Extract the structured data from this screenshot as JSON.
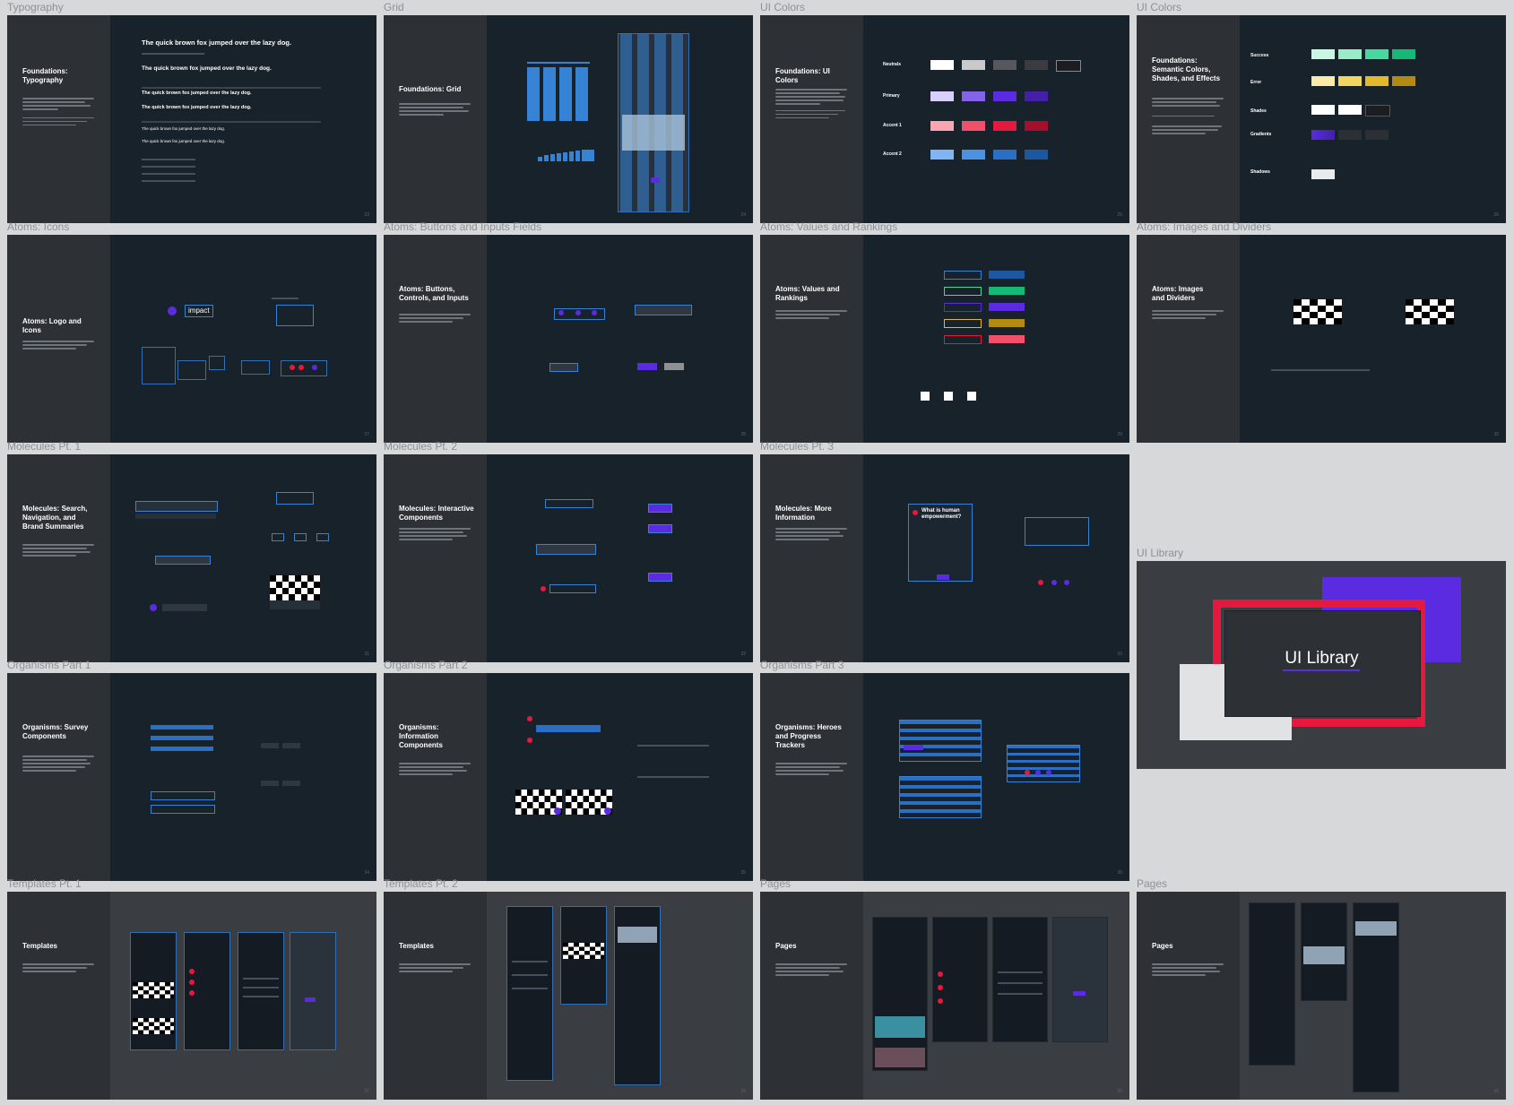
{
  "frames": [
    {
      "label": "Typography",
      "title": "Foundations:\nTypography",
      "page": "23",
      "sample": "The quick brown fox jumped over the lazy dog."
    },
    {
      "label": "Grid",
      "title": "Foundations: Grid",
      "page": "24"
    },
    {
      "label": "UI Colors",
      "title": "Foundations: UI Colors",
      "page": "25",
      "rows": [
        "Neutrals",
        "Primary",
        "Accent 1",
        "Accent 2"
      ]
    },
    {
      "label": "UI Colors",
      "title": "Foundations:\nSemantic Colors,\nShades, and Effects",
      "page": "26",
      "rows": [
        "Success",
        "Error",
        "Shades",
        "Gradients",
        "Shadows"
      ]
    },
    {
      "label": "Atoms: Icons",
      "title": "Atoms: Logo and Icons",
      "page": "27",
      "logo": "impact"
    },
    {
      "label": "Atoms: Buttons and Inputs Fields",
      "title": "Atoms: Buttons,\nControls, and Inputs",
      "page": "28"
    },
    {
      "label": "Atoms: Values and Rankings",
      "title": "Atoms: Values and\nRankings",
      "page": "29"
    },
    {
      "label": "Atoms: Images and Dividers",
      "title": "Atoms: Images\nand Dividers",
      "page": "30"
    },
    {
      "label": "Molecules Pt. 1",
      "title": "Molecules: Search,\nNavigation, and\nBrand Summaries",
      "page": "31"
    },
    {
      "label": "Molecules Pt. 2",
      "title": "Molecules: Interactive\nComponents",
      "page": "32"
    },
    {
      "label": "Molecules Pt. 3",
      "title": "Molecules: More\nInformation",
      "page": "33",
      "card": "What is human\nempowerment?"
    },
    {
      "label": "UI Library",
      "title": "UI Library"
    },
    {
      "label": "Organisms Part 1",
      "title": "Organisms: Survey\nComponents",
      "page": "34"
    },
    {
      "label": "Organisms Part 2",
      "title": "Organisms:\nInformation\nComponents",
      "page": "35"
    },
    {
      "label": "Organisms Part 3",
      "title": "Organisms: Heroes\nand Progress\nTrackers",
      "page": "36"
    },
    {
      "label": "Templates Pt. 1",
      "title": "Templates",
      "page": "37"
    },
    {
      "label": "Templates Pt. 2",
      "title": "Templates",
      "page": "38"
    },
    {
      "label": "Pages",
      "title": "Pages",
      "page": "39"
    },
    {
      "label": "Pages",
      "title": "Pages",
      "page": "40"
    }
  ],
  "colors": {
    "neutrals": [
      "#ffffff",
      "#c9c9cc",
      "#56585c",
      "#3a3c40",
      "#1b1d20"
    ],
    "primary": [
      "#d8d0fb",
      "#8563e8",
      "#5a2be0",
      "#4420a8"
    ],
    "accent1": [
      "#f9a6b3",
      "#f0506a",
      "#e4193d",
      "#a60f2b"
    ],
    "accent2": [
      "#80b5f3",
      "#4b92e0",
      "#2a6fc3",
      "#1d57a0"
    ],
    "success": [
      "#c8f6e1",
      "#98ecc8",
      "#48d79c",
      "#16b876"
    ],
    "error": [
      "#fbeaa9",
      "#f3d661",
      "#e2b82d",
      "#b38a12"
    ]
  },
  "ui_library": {
    "accent_red": "#e4193d",
    "accent_purple": "#5a2be0"
  }
}
